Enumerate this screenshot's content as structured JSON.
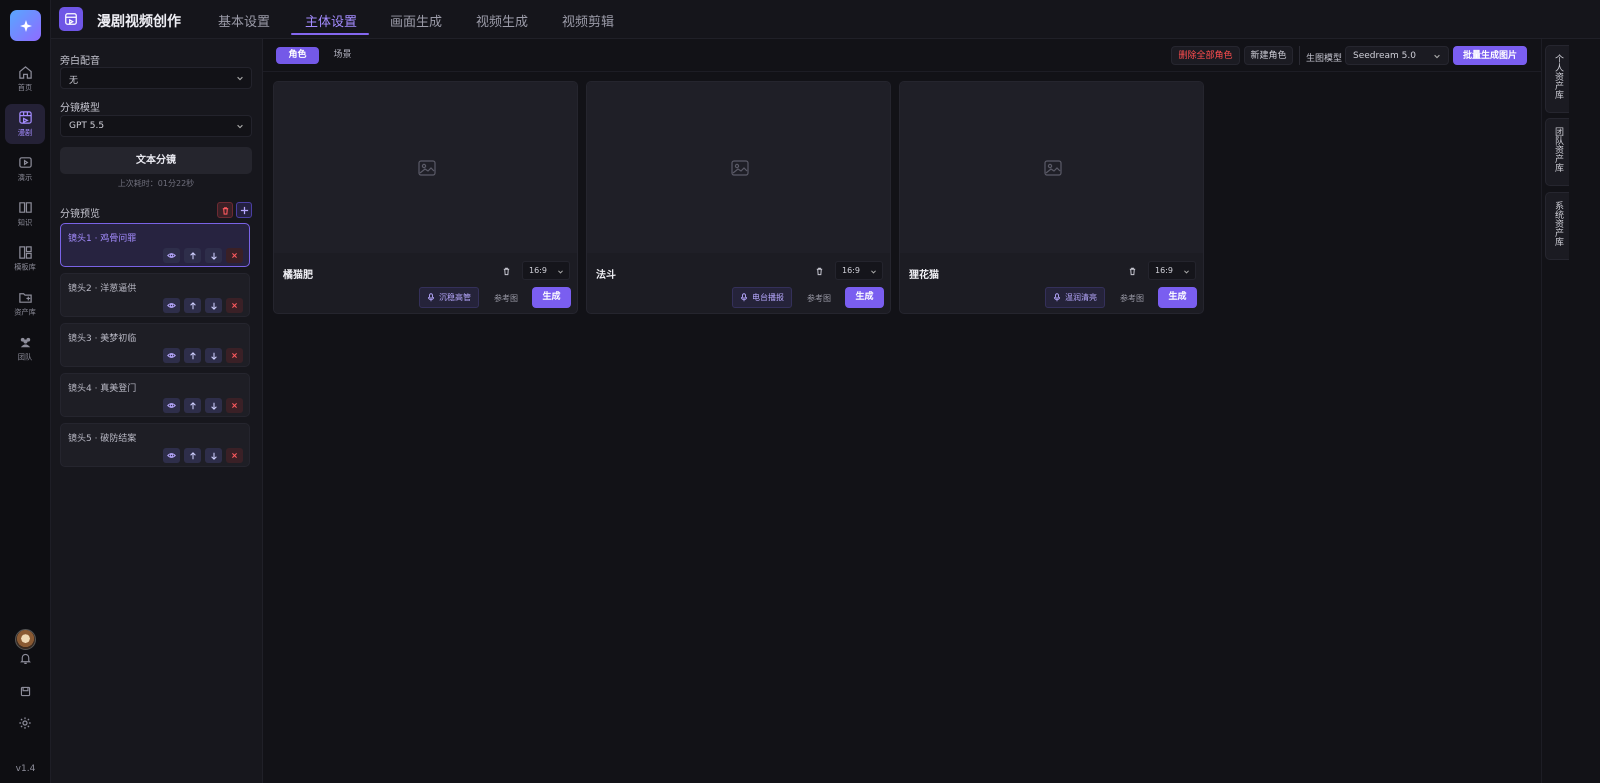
{
  "app": {
    "title": "漫剧视频创作",
    "version": "v1.4"
  },
  "rail": {
    "items": [
      {
        "label": "首页",
        "icon": "home-icon"
      },
      {
        "label": "漫剧",
        "icon": "storyboard-icon",
        "active": true
      },
      {
        "label": "演示",
        "icon": "play-icon"
      },
      {
        "label": "知识",
        "icon": "book-icon"
      },
      {
        "label": "模板库",
        "icon": "template-icon"
      },
      {
        "label": "资产库",
        "icon": "folder-icon"
      },
      {
        "label": "团队",
        "icon": "team-icon"
      }
    ]
  },
  "tabs": [
    "基本设置",
    "主体设置",
    "画面生成",
    "视频生成",
    "视频剪辑"
  ],
  "active_tab": "主体设置",
  "panel": {
    "narration_label": "旁白配音",
    "narration_value": "无",
    "model_label": "分镜模型",
    "model_value": "GPT 5.5",
    "split_button": "文本分镜",
    "last_time": "上次耗时：01分22秒",
    "preview_label": "分镜预览",
    "shots": [
      {
        "label": "镜头1 · 鸡骨问罪",
        "active": true
      },
      {
        "label": "镜头2 · 洋葱逼供"
      },
      {
        "label": "镜头3 · 美梦初临"
      },
      {
        "label": "镜头4 · 真美登门"
      },
      {
        "label": "镜头5 · 破防结案"
      }
    ]
  },
  "toolbar": {
    "subtabs": [
      "角色",
      "场景"
    ],
    "delete_all": "删除全部角色",
    "new_role": "新建角色",
    "model_label": "生图模型",
    "model_value": "Seedream 5.0",
    "batch_generate": "批量生成图片"
  },
  "cards": [
    {
      "name": "橘猫肥",
      "ratio": "16:9",
      "voice": "沉稳高管",
      "ref": "参考图",
      "generate": "生成"
    },
    {
      "name": "法斗",
      "ratio": "16:9",
      "voice": "电台播报",
      "ref": "参考图",
      "generate": "生成"
    },
    {
      "name": "狸花猫",
      "ratio": "16:9",
      "voice": "温润清亮",
      "ref": "参考图",
      "generate": "生成"
    }
  ],
  "right_tabs": [
    "个人资产库",
    "团队资产库",
    "系统资产库"
  ],
  "colors": {
    "accent": "#7a5ef0",
    "danger": "#ff4d4f",
    "bg": "#121217"
  }
}
